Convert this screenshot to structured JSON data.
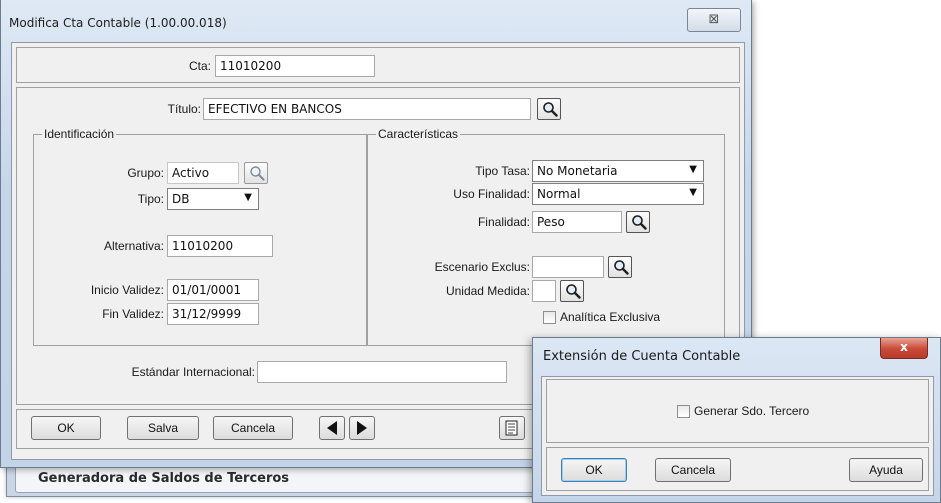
{
  "main_dialog": {
    "title": "Modifica Cta Contable (1.00.00.018)",
    "close_glyph": "⊠",
    "cta_label": "Cta:",
    "cta_value": "11010200",
    "titulo_label": "Título:",
    "titulo_value": "EFECTIVO EN BANCOS",
    "identificacion": {
      "title": "Identificación",
      "grupo_label": "Grupo:",
      "grupo_value": "Activo",
      "tipo_label": "Tipo:",
      "tipo_value": "DB",
      "alternativa_label": "Alternativa:",
      "alternativa_value": "11010200",
      "inicio_label": "Inicio Validez:",
      "inicio_value": "01/01/0001",
      "fin_label": "Fin Validez:",
      "fin_value": "31/12/9999"
    },
    "caracteristicas": {
      "title": "Características",
      "tipo_tasa_label": "Tipo Tasa:",
      "tipo_tasa_value": "No Monetaria",
      "uso_finalidad_label": "Uso Finalidad:",
      "uso_finalidad_value": "Normal",
      "finalidad_label": "Finalidad:",
      "finalidad_value": "Peso",
      "escenario_label": "Escenario Exclus:",
      "escenario_value": "",
      "unidad_label": "Unidad Medida:",
      "unidad_value": "",
      "analitica_label": "Analítica Exclusiva"
    },
    "estandar_label": "Estándar Internacional:",
    "estandar_value": "",
    "buttons": {
      "ok": "OK",
      "salva": "Salva",
      "cancela": "Cancela"
    }
  },
  "background_window": {
    "caption": "Generadora de Saldos de Terceros"
  },
  "popup": {
    "title": "Extensión de Cuenta Contable",
    "close_glyph": "x",
    "checkbox_label": "Generar Sdo. Tercero",
    "buttons": {
      "ok": "OK",
      "cancela": "Cancela",
      "ayuda": "Ayuda"
    }
  }
}
